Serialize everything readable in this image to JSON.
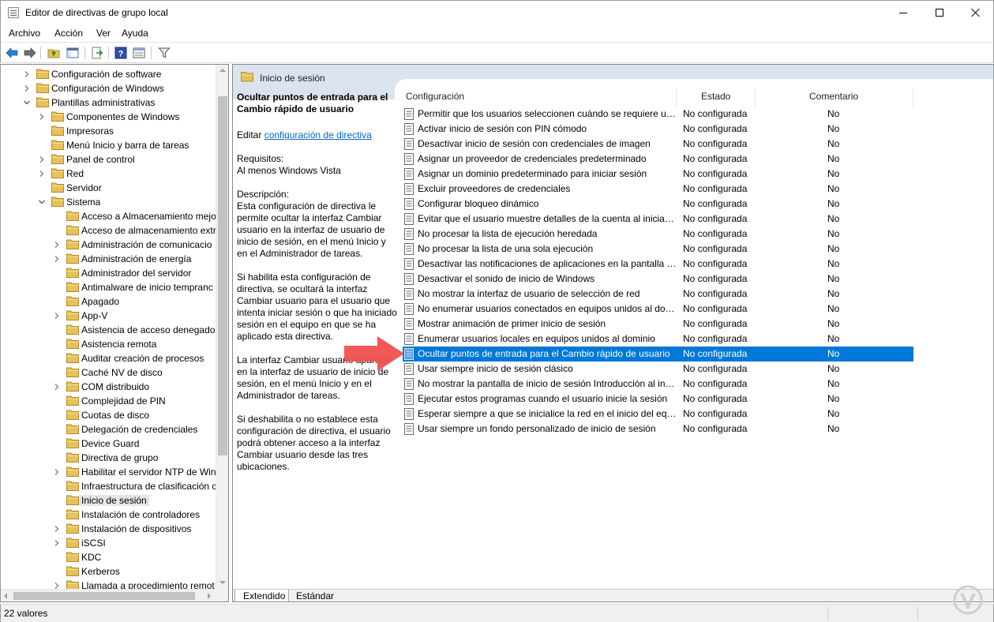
{
  "window": {
    "title": "Editor de directivas de grupo local"
  },
  "menu": [
    "Archivo",
    "Acción",
    "Ver",
    "Ayuda"
  ],
  "toolbar": {
    "icons": [
      "back-arrow-icon",
      "forward-arrow-icon",
      "up-folder-icon",
      "show-hide-tree-icon",
      "export-list-icon",
      "help-icon",
      "properties-icon",
      "filter-icon"
    ]
  },
  "tree": {
    "items": [
      {
        "label": "Configuración de software",
        "level": 1,
        "expander": "collapsed"
      },
      {
        "label": "Configuración de Windows",
        "level": 1,
        "expander": "collapsed"
      },
      {
        "label": "Plantillas administrativas",
        "level": 1,
        "expander": "expanded"
      },
      {
        "label": "Componentes de Windows",
        "level": 2,
        "expander": "collapsed"
      },
      {
        "label": "Impresoras",
        "level": 2,
        "expander": "none"
      },
      {
        "label": "Menú Inicio y barra de tareas",
        "level": 2,
        "expander": "none"
      },
      {
        "label": "Panel de control",
        "level": 2,
        "expander": "collapsed"
      },
      {
        "label": "Red",
        "level": 2,
        "expander": "collapsed"
      },
      {
        "label": "Servidor",
        "level": 2,
        "expander": "none"
      },
      {
        "label": "Sistema",
        "level": 2,
        "expander": "expanded"
      },
      {
        "label": "Acceso a Almacenamiento mejo",
        "level": 3,
        "expander": "none"
      },
      {
        "label": "Acceso de almacenamiento extr",
        "level": 3,
        "expander": "none"
      },
      {
        "label": "Administración de comunicacio",
        "level": 3,
        "expander": "collapsed"
      },
      {
        "label": "Administración de energía",
        "level": 3,
        "expander": "collapsed"
      },
      {
        "label": "Administrador del servidor",
        "level": 3,
        "expander": "none"
      },
      {
        "label": "Antimalware de inicio tempranc",
        "level": 3,
        "expander": "none"
      },
      {
        "label": "Apagado",
        "level": 3,
        "expander": "none"
      },
      {
        "label": "App-V",
        "level": 3,
        "expander": "collapsed"
      },
      {
        "label": "Asistencia de acceso denegado",
        "level": 3,
        "expander": "none"
      },
      {
        "label": "Asistencia remota",
        "level": 3,
        "expander": "none"
      },
      {
        "label": "Auditar creación de procesos",
        "level": 3,
        "expander": "none"
      },
      {
        "label": "Caché NV de disco",
        "level": 3,
        "expander": "none"
      },
      {
        "label": "COM distribuido",
        "level": 3,
        "expander": "collapsed"
      },
      {
        "label": "Complejidad de PIN",
        "level": 3,
        "expander": "none"
      },
      {
        "label": "Cuotas de disco",
        "level": 3,
        "expander": "none"
      },
      {
        "label": "Delegación de credenciales",
        "level": 3,
        "expander": "none"
      },
      {
        "label": "Device Guard",
        "level": 3,
        "expander": "none"
      },
      {
        "label": "Directiva de grupo",
        "level": 3,
        "expander": "none"
      },
      {
        "label": "Habilitar el servidor NTP de Win",
        "level": 3,
        "expander": "collapsed"
      },
      {
        "label": "Infraestructura de clasificación c",
        "level": 3,
        "expander": "none"
      },
      {
        "label": "Inicio de sesión",
        "level": 3,
        "expander": "none",
        "selected": true
      },
      {
        "label": "Instalación de controladores",
        "level": 3,
        "expander": "none"
      },
      {
        "label": "Instalación de dispositivos",
        "level": 3,
        "expander": "collapsed"
      },
      {
        "label": "iSCSI",
        "level": 3,
        "expander": "collapsed"
      },
      {
        "label": "KDC",
        "level": 3,
        "expander": "none"
      },
      {
        "label": "Kerberos",
        "level": 3,
        "expander": "none"
      },
      {
        "label": "Llamada a procedimiento remot",
        "level": 3,
        "expander": "collapsed"
      }
    ]
  },
  "header": {
    "title": "Inicio de sesión"
  },
  "description": {
    "title": "Ocultar puntos de entrada para el Cambio rápido de usuario",
    "edit_prefix": "Editar ",
    "edit_link": "configuración de directiva",
    "requirements": "Requisitos:\nAl menos Windows Vista",
    "paragraphs": [
      "Descripción:\nEsta configuración de directiva le permite ocultar la interfaz Cambiar usuario en la interfaz de usuario de inicio de sesión, en el menú Inicio y en el Administrador de tareas.",
      "Si habilita esta configuración de directiva, se ocultará la interfaz Cambiar usuario para el usuario que intenta iniciar sesión o que ha iniciado sesión en el equipo en que se ha aplicado esta directiva.",
      "La interfaz Cambiar usuario aparece en la interfaz de usuario de inicio de sesión, en el menú Inicio y en el Administrador de tareas.",
      "Si deshabilita o no establece esta configuración de directiva, el usuario podrá obtener acceso a la interfaz Cambiar usuario desde las tres ubicaciones."
    ]
  },
  "list": {
    "columns": {
      "setting": "Configuración",
      "state": "Estado",
      "comment": "Comentario"
    },
    "rows": [
      {
        "name": "Permitir que los usuarios seleccionen cuándo se requiere una contraseña al reanudar desde el modo de espera conectado",
        "state": "No configurada",
        "comment": "No"
      },
      {
        "name": "Activar inicio de sesión con PIN cómodo",
        "state": "No configurada",
        "comment": "No"
      },
      {
        "name": "Desactivar inicio de sesión con credenciales de imagen",
        "state": "No configurada",
        "comment": "No"
      },
      {
        "name": "Asignar un proveedor de credenciales predeterminado",
        "state": "No configurada",
        "comment": "No"
      },
      {
        "name": "Asignar un dominio predeterminado para iniciar sesión",
        "state": "No configurada",
        "comment": "No"
      },
      {
        "name": "Excluir proveedores de credenciales",
        "state": "No configurada",
        "comment": "No"
      },
      {
        "name": "Configurar bloqueo dinámico",
        "state": "No configurada",
        "comment": "No"
      },
      {
        "name": "Evitar que el usuario muestre detalles de la cuenta al iniciar sesión",
        "state": "No configurada",
        "comment": "No"
      },
      {
        "name": "No procesar la lista de ejecución heredada",
        "state": "No configurada",
        "comment": "No"
      },
      {
        "name": "No procesar la lista de una sola ejecución",
        "state": "No configurada",
        "comment": "No"
      },
      {
        "name": "Desactivar las notificaciones de aplicaciones en la pantalla de bloqueo",
        "state": "No configurada",
        "comment": "No"
      },
      {
        "name": "Desactivar el sonido de inicio de Windows",
        "state": "No configurada",
        "comment": "No"
      },
      {
        "name": "No mostrar la interfaz de usuario de selección de red",
        "state": "No configurada",
        "comment": "No"
      },
      {
        "name": "No enumerar usuarios conectados en equipos unidos al dominio",
        "state": "No configurada",
        "comment": "No"
      },
      {
        "name": "Mostrar animación de primer inicio de sesión",
        "state": "No configurada",
        "comment": "No"
      },
      {
        "name": "Enumerar usuarios locales en equipos unidos al dominio",
        "state": "No configurada",
        "comment": "No"
      },
      {
        "name": "Ocultar puntos de entrada para el Cambio rápido de usuario",
        "state": "No configurada",
        "comment": "No",
        "selected": true
      },
      {
        "name": "Usar siempre inicio de sesión clásico",
        "state": "No configurada",
        "comment": "No"
      },
      {
        "name": "No mostrar la pantalla de inicio de sesión Introducción al iniciar sesión",
        "state": "No configurada",
        "comment": "No"
      },
      {
        "name": "Ejecutar estos programas cuando el usuario inicie la sesión",
        "state": "No configurada",
        "comment": "No"
      },
      {
        "name": "Esperar siempre a que se inicialice la red en el inicio del equipo y el inicio de sesión",
        "state": "No configurada",
        "comment": "No"
      },
      {
        "name": "Usar siempre un fondo personalizado de inicio de sesión",
        "state": "No configurada",
        "comment": "No"
      }
    ]
  },
  "tabs": [
    "Extendido",
    "Estándar"
  ],
  "status": {
    "text": "22 valores"
  },
  "colors": {
    "selection": "#0078d7",
    "header_band": "#dbe4ee",
    "link": "#0066cc",
    "annotation_arrow": "#f0504f",
    "folder": "#e8c15a"
  }
}
